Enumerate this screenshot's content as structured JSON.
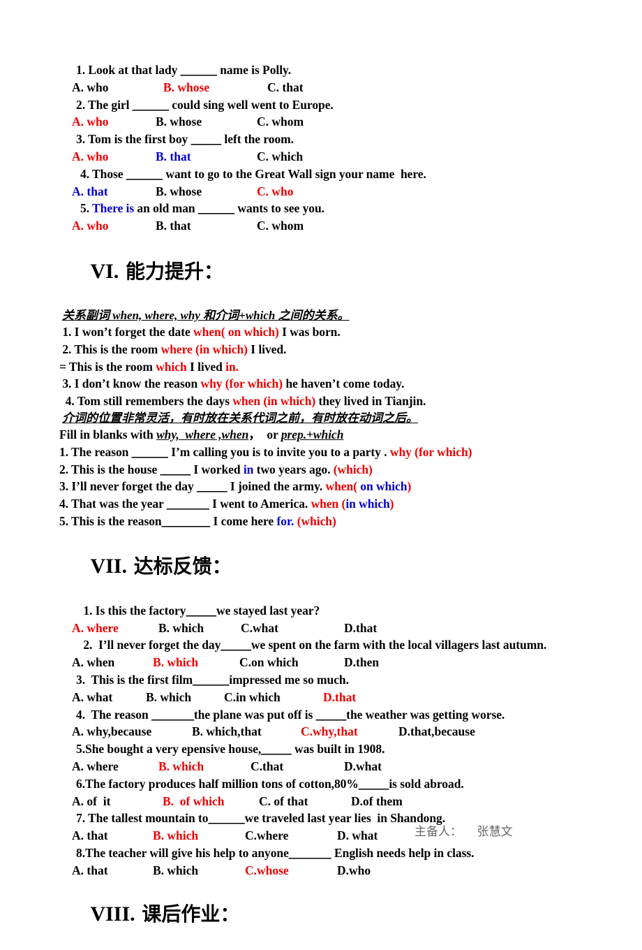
{
  "document": {
    "section_v_questions": [
      {
        "stem": [
          {
            "t": "1. Look at that lady ",
            "c": "black"
          },
          {
            "t": "______",
            "c": "black",
            "u": true
          },
          {
            "t": " name is Polly.",
            "c": "black"
          }
        ],
        "options": [
          {
            "t": "A. who",
            "c": "black"
          },
          {
            "t": "B. whose",
            "c": "red"
          },
          {
            "t": "C. that",
            "c": "black"
          }
        ],
        "option_cols": "0px,131px,280px",
        "stem_indent": "ind1",
        "opt_indent": "ind1"
      },
      {
        "stem": [
          {
            "t": "2. The girl ",
            "c": "black"
          },
          {
            "t": "______",
            "c": "black",
            "u": true
          },
          {
            "t": " could sing well went to Europe.",
            "c": "black"
          }
        ],
        "options": [
          {
            "t": "A. who",
            "c": "red"
          },
          {
            "t": "B. whose",
            "c": "black"
          },
          {
            "t": "C. whom",
            "c": "black"
          }
        ],
        "option_cols": "0px,120px,265px",
        "stem_indent": "ind1",
        "opt_indent": "ind2"
      },
      {
        "stem": [
          {
            "t": "3. Tom is the first boy ",
            "c": "black"
          },
          {
            "t": "_____",
            "c": "black",
            "u": true
          },
          {
            "t": " left the room.",
            "c": "black"
          }
        ],
        "options": [
          {
            "t": "A. who",
            "c": "red"
          },
          {
            "t": "B. that",
            "c": "blue"
          },
          {
            "t": "C. which",
            "c": "black"
          }
        ],
        "option_cols": "0px,120px,265px",
        "stem_indent": "ind1",
        "opt_indent": "ind2"
      },
      {
        "stem": [
          {
            "t": "4. Those ",
            "c": "black"
          },
          {
            "t": "______",
            "c": "black",
            "u": true
          },
          {
            "t": " want to go to the Great Wall sign your name  here.",
            "c": "black"
          }
        ],
        "options": [
          {
            "t": "A. that",
            "c": "blue"
          },
          {
            "t": "B. whose",
            "c": "black"
          },
          {
            "t": "C. who",
            "c": "red"
          }
        ],
        "option_cols": "0px,120px,265px",
        "stem_indent": "ind2",
        "opt_indent": "ind2"
      },
      {
        "stem": [
          {
            "t": "5. ",
            "c": "black"
          },
          {
            "t": "There is",
            "c": "blue"
          },
          {
            "t": " an old man ",
            "c": "black"
          },
          {
            "t": "______",
            "c": "black",
            "u": true
          },
          {
            "t": " wants to see you.",
            "c": "black"
          }
        ],
        "options": [
          {
            "t": "A. who",
            "c": "red"
          },
          {
            "t": "B. that",
            "c": "black"
          },
          {
            "t": "C. whom",
            "c": "black"
          }
        ],
        "option_cols": "0px,120px,265px",
        "stem_indent": "ind2",
        "opt_indent": "ind2"
      }
    ],
    "heading_vi": {
      "numeral": "VI.",
      "cjk": " 能力提升："
    },
    "subtitle_vi": "关系副词 when, where, why 和介词+which 之间的关系。",
    "section_vi_examples": [
      [
        {
          "t": " 1. I won’t forget the date ",
          "c": "black"
        },
        {
          "t": "when( on which)",
          "c": "red"
        },
        {
          "t": " I was born.",
          "c": "black"
        }
      ],
      [
        {
          "t": " 2. This is the room ",
          "c": "black"
        },
        {
          "t": "where (in which)",
          "c": "red"
        },
        {
          "t": " I lived.",
          "c": "black"
        }
      ],
      [
        {
          "t": "= This is the room ",
          "c": "black"
        },
        {
          "t": "which",
          "c": "red"
        },
        {
          "t": " I lived ",
          "c": "black"
        },
        {
          "t": "in.",
          "c": "red"
        }
      ],
      [
        {
          "t": " 3. I don’t know the reason ",
          "c": "black"
        },
        {
          "t": "why (for which)",
          "c": "red"
        },
        {
          "t": " he haven’t come today.",
          "c": "black"
        }
      ],
      [
        {
          "t": "  4. Tom still remembers the days ",
          "c": "black"
        },
        {
          "t": "when (in which)",
          "c": "red"
        },
        {
          "t": " they lived in Tianjin.",
          "c": "black"
        }
      ]
    ],
    "note_vi": "介词的位置非常灵活，有时放在关系代词之前，有时放在动词之后。",
    "fill_instruction": {
      "prefix": "Fill in blanks with ",
      "u1": "why,  where ,when",
      "mid": "，  or ",
      "u2": "prep.+which"
    },
    "section_vi_fill": [
      [
        {
          "t": "1. The reason ",
          "c": "black"
        },
        {
          "t": "______",
          "c": "black",
          "u": true
        },
        {
          "t": " I’m calling you is to invite you to a party . ",
          "c": "black"
        },
        {
          "t": "why (for which)",
          "c": "red"
        }
      ],
      [
        {
          "t": "2. This is the house ",
          "c": "black"
        },
        {
          "t": "_____",
          "c": "black",
          "u": true
        },
        {
          "t": " I worked ",
          "c": "black"
        },
        {
          "t": "in",
          "c": "blue"
        },
        {
          "t": " two years ago. ",
          "c": "black"
        },
        {
          "t": "(which)",
          "c": "red"
        }
      ],
      [
        {
          "t": "3. I’ll never forget the day ",
          "c": "black"
        },
        {
          "t": "_____",
          "c": "black",
          "u": true
        },
        {
          "t": " I joined the army. ",
          "c": "black"
        },
        {
          "t": "when( ",
          "c": "red"
        },
        {
          "t": "on which",
          "c": "blue"
        },
        {
          "t": ")",
          "c": "red"
        }
      ],
      [
        {
          "t": "4. That was the year ",
          "c": "black"
        },
        {
          "t": "_______",
          "c": "black",
          "u": true
        },
        {
          "t": " I went to America. ",
          "c": "black"
        },
        {
          "t": "when (",
          "c": "red"
        },
        {
          "t": "in which",
          "c": "blue"
        },
        {
          "t": ")",
          "c": "red"
        }
      ],
      [
        {
          "t": "5. This is the reason",
          "c": "black"
        },
        {
          "t": "________",
          "c": "black",
          "u": true
        },
        {
          "t": " I come here ",
          "c": "black"
        },
        {
          "t": "for.",
          "c": "blue"
        },
        {
          "t": " (which)",
          "c": "red"
        }
      ]
    ],
    "heading_vii": {
      "numeral": "VII.",
      "cjk": " 达标反馈："
    },
    "section_vii_questions": [
      {
        "stem": [
          {
            "t": " 1. Is this the factory",
            "c": "black"
          },
          {
            "t": "_____",
            "c": "black",
            "u": true
          },
          {
            "t": "we stayed last year?",
            "c": "black"
          }
        ],
        "options": [
          {
            "t": "A. where",
            "c": "red"
          },
          {
            "t": "B. which",
            "c": "black"
          },
          {
            "t": "C.what",
            "c": "black"
          },
          {
            "t": "D.that",
            "c": "black"
          }
        ],
        "option_cols": "0px,124px,242px,390px",
        "stem_indent": "ind2",
        "opt_indent": "ind1"
      },
      {
        "stem": [
          {
            "t": " 2.  I’ll never forget the day",
            "c": "black"
          },
          {
            "t": "_____",
            "c": "black",
            "u": true
          },
          {
            "t": "we spent on the farm with the local villagers last autumn.",
            "c": "black"
          }
        ],
        "options": [
          {
            "t": "A. when",
            "c": "black"
          },
          {
            "t": "B. which",
            "c": "red"
          },
          {
            "t": "C.on which",
            "c": "black"
          },
          {
            "t": "D.then",
            "c": "black"
          }
        ],
        "option_cols": "0px,116px,240px,390px",
        "stem_indent": "ind2",
        "opt_indent": "ind0"
      },
      {
        "stem": [
          {
            "t": "3.  This is the first film",
            "c": "black"
          },
          {
            "t": "______",
            "c": "black",
            "u": true
          },
          {
            "t": "impressed me so much.",
            "c": "black"
          }
        ],
        "options": [
          {
            "t": "A. what",
            "c": "black"
          },
          {
            "t": "B. which",
            "c": "black"
          },
          {
            "t": "C.in which",
            "c": "black"
          },
          {
            "t": "D.that",
            "c": "red"
          }
        ],
        "option_cols": "0px,106px,218px,360px",
        "stem_indent": "ind1",
        "opt_indent": "ind1"
      },
      {
        "stem": [
          {
            "t": "4.  The reason ",
            "c": "black"
          },
          {
            "t": "_______",
            "c": "black",
            "u": true
          },
          {
            "t": "the plane was put off is ",
            "c": "black"
          },
          {
            "t": "_____",
            "c": "black",
            "u": true
          },
          {
            "t": "the weather was getting worse.",
            "c": "black"
          }
        ],
        "options": [
          {
            "t": "A. why,because",
            "c": "black"
          },
          {
            "t": "B. which,that",
            "c": "black"
          },
          {
            "t": "C.why,that",
            "c": "red"
          },
          {
            "t": "D.that,because",
            "c": "black"
          }
        ],
        "option_cols": "0px,172px,328px,468px",
        "stem_indent": "ind1",
        "opt_indent": "ind0"
      },
      {
        "stem": [
          {
            "t": "5.She bought a very epensive house,",
            "c": "black"
          },
          {
            "t": "_____",
            "c": "black",
            "u": true
          },
          {
            "t": " was built in 1908.",
            "c": "black"
          }
        ],
        "options": [
          {
            "t": "A. where",
            "c": "black"
          },
          {
            "t": "B. which",
            "c": "red"
          },
          {
            "t": "C.that",
            "c": "black"
          },
          {
            "t": "D.what",
            "c": "black"
          }
        ],
        "option_cols": "0px,124px,256px,390px",
        "stem_indent": "ind1",
        "opt_indent": "ind0"
      },
      {
        "stem": [
          {
            "t": "6.The factory produces half million tons of cotton,80%",
            "c": "black"
          },
          {
            "t": "_____",
            "c": "black",
            "u": true
          },
          {
            "t": "is sold abroad.",
            "c": "black"
          }
        ],
        "options": [
          {
            "t": "A. of  it",
            "c": "black"
          },
          {
            "t": "B.  of which",
            "c": "red"
          },
          {
            "t": "C. of that",
            "c": "black"
          },
          {
            "t": "D.of them",
            "c": "black"
          }
        ],
        "option_cols": "0px,130px,268px,400px",
        "stem_indent": "ind1",
        "opt_indent": "ind3"
      },
      {
        "stem": [
          {
            "t": "7. The tallest mountain to",
            "c": "black"
          },
          {
            "t": "______",
            "c": "black",
            "u": true
          },
          {
            "t": "we traveled last year lies  in Shandong.",
            "c": "black"
          }
        ],
        "options": [
          {
            "t": "A. that",
            "c": "black"
          },
          {
            "t": "B. which",
            "c": "red"
          },
          {
            "t": "C.where",
            "c": "black"
          },
          {
            "t": "D. what",
            "c": "black"
          }
        ],
        "option_cols": "0px,116px,248px,380px",
        "stem_indent": "ind1",
        "opt_indent": "ind0"
      },
      {
        "stem": [
          {
            "t": "8.The teacher will give his help to anyone",
            "c": "black"
          },
          {
            "t": "_______",
            "c": "black",
            "u": true
          },
          {
            "t": " English needs help in class.",
            "c": "black"
          }
        ],
        "options": [
          {
            "t": "A. that",
            "c": "black"
          },
          {
            "t": "B. which",
            "c": "black"
          },
          {
            "t": "C.whose",
            "c": "red"
          },
          {
            "t": "D.who",
            "c": "black"
          }
        ],
        "option_cols": "0px,116px,248px,380px",
        "stem_indent": "ind1",
        "opt_indent": "ind0"
      }
    ],
    "heading_viii": {
      "numeral": "VIII.",
      "cjk": " 课后作业："
    },
    "footer": "主备人：    张慧文"
  },
  "colors": {
    "red": "#ee0000",
    "blue": "#0000cc",
    "black": "#000000",
    "footer_gray": "#666666"
  }
}
